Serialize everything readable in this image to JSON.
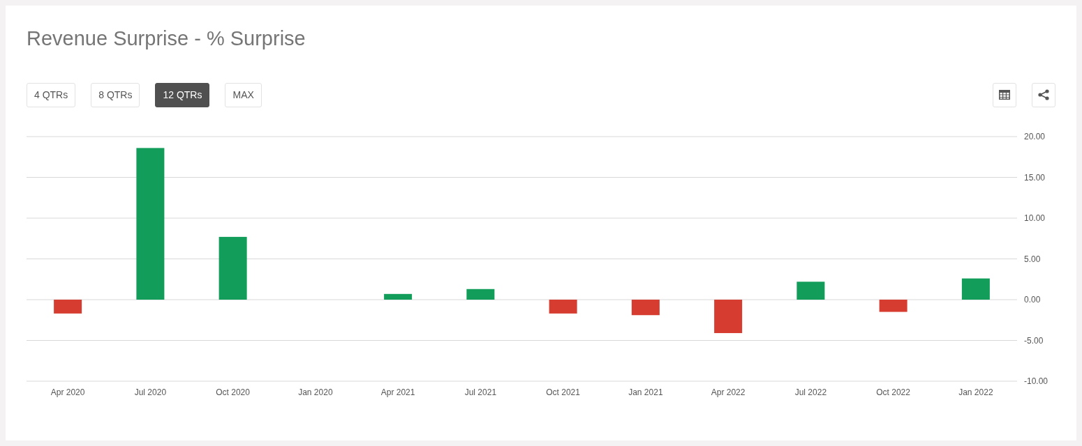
{
  "title": "Revenue Surprise - % Surprise",
  "ranges": [
    {
      "label": "4 QTRs",
      "selected": false
    },
    {
      "label": "8 QTRs",
      "selected": false
    },
    {
      "label": "12 QTRs",
      "selected": true
    },
    {
      "label": "MAX",
      "selected": false
    }
  ],
  "chart_data": {
    "type": "bar",
    "categories": [
      "Apr 2020",
      "Jul 2020",
      "Oct 2020",
      "Jan 2020",
      "Apr 2021",
      "Jul 2021",
      "Oct 2021",
      "Jan 2021",
      "Apr 2022",
      "Jul 2022",
      "Oct 2022",
      "Jan 2022"
    ],
    "series": [
      {
        "color": "#129e5a",
        "values": [
          null,
          18.6,
          7.7,
          0,
          0.7,
          1.3,
          null,
          null,
          null,
          2.2,
          null,
          2.6
        ]
      },
      {
        "color": "#d63d30",
        "values": [
          -1.7,
          null,
          null,
          null,
          null,
          null,
          -1.7,
          -1.9,
          -4.1,
          null,
          -1.5,
          null
        ]
      }
    ],
    "stacked": true,
    "grid": true,
    "ylim": [
      -10,
      20
    ],
    "yticks": [
      {
        "value": 20,
        "label": "20.00"
      },
      {
        "value": 15,
        "label": "15.00"
      },
      {
        "value": 10,
        "label": "10.00"
      },
      {
        "value": 5,
        "label": "5.00"
      },
      {
        "value": 0,
        "label": "0.00"
      },
      {
        "value": -5,
        "label": "-5.00"
      },
      {
        "value": -10,
        "label": "-10.00"
      }
    ]
  }
}
